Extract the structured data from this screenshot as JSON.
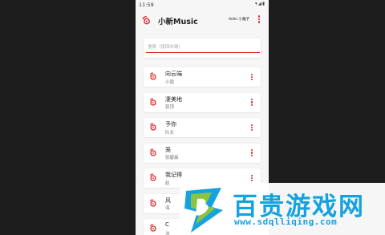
{
  "status": {
    "time": "11:59",
    "icons": "▾◢▮"
  },
  "app": {
    "title": "小新Music",
    "greeting": "Hello 小魔子"
  },
  "search": {
    "placeholder": "搜索（按回车键）"
  },
  "songs": [
    {
      "title": "向云端",
      "artist": "小霞"
    },
    {
      "title": "凄美地",
      "artist": "郭顶"
    },
    {
      "title": "予你",
      "artist": "队长"
    },
    {
      "title": "笼",
      "artist": "张碧晨"
    },
    {
      "title": "我记得",
      "artist": "赵"
    },
    {
      "title": "风",
      "artist": "海"
    },
    {
      "title": "C",
      "artist": "沐"
    }
  ],
  "watermark": {
    "title": "百贵游戏网",
    "url": "www.sdqlliqing.com"
  },
  "colors": {
    "accent": "#e0252b",
    "watermark_blue": "#16a2df",
    "watermark_green": "#8bc53f"
  }
}
